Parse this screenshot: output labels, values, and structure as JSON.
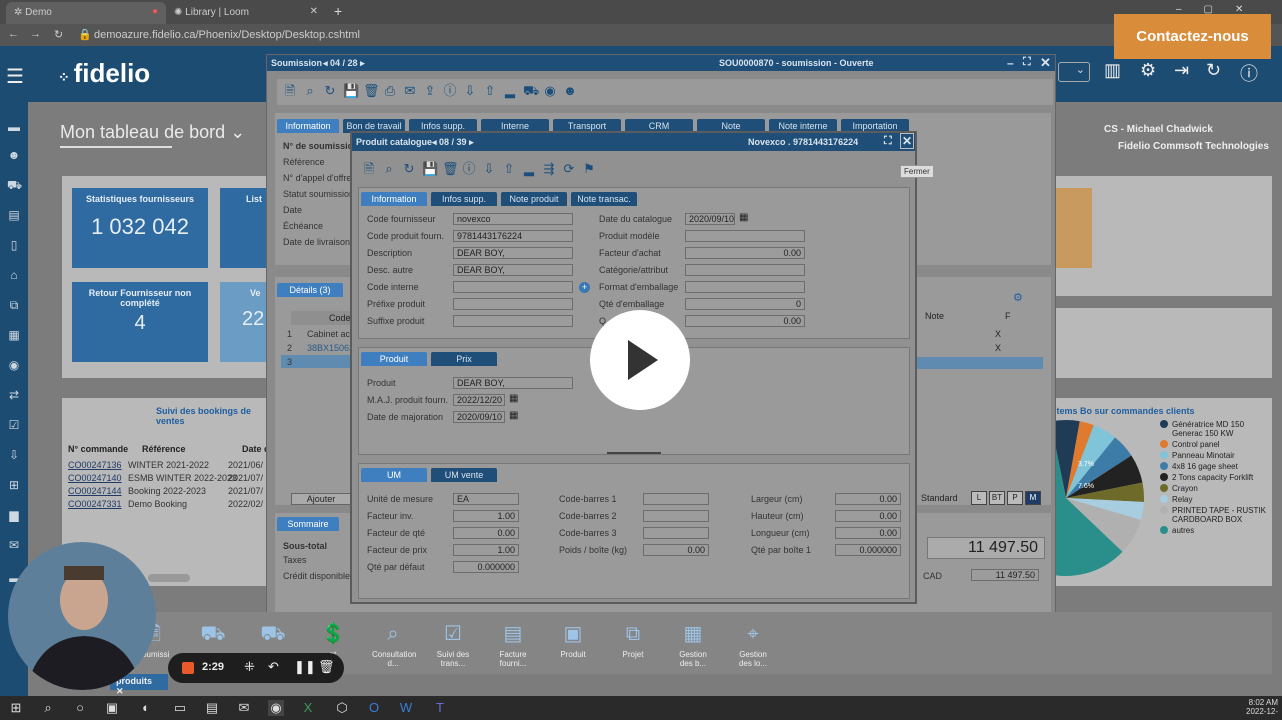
{
  "browser": {
    "tabs": [
      {
        "label": "Demo"
      },
      {
        "label": "Library | Loom"
      }
    ],
    "url": "demoazure.fidelio.ca/Phoenix/Desktop/Desktop.cshtml",
    "new_tab": "+"
  },
  "app": {
    "logo": "fidelio",
    "dashboard_title": "Mon tableau de bord",
    "user": "CS - Michael Chadwick",
    "company": "Fidelio Commsoft Technologies"
  },
  "tiles": [
    {
      "title": "Statistiques fournisseurs",
      "value": "1 032 042"
    },
    {
      "title": "List",
      "value": ""
    },
    {
      "title": "Retour Fournisseur non complété",
      "value": "4"
    },
    {
      "title": "Ve",
      "value": "22"
    }
  ],
  "soumission": {
    "title_prefix": "Soumission",
    "nav": "04 / 28",
    "header": "SOU0000870 - soumission - Ouverte",
    "tabs": [
      "Information",
      "Bon de travail",
      "Infos supp.",
      "Interne",
      "Transport",
      "CRM",
      "Note",
      "Note interne",
      "Importation"
    ],
    "labels": [
      "N° de soumission",
      "Référence",
      "N° d'appel d'offre",
      "Statut soumission",
      "Date",
      "Échéance",
      "Date de livraison"
    ],
    "details_tab": "Détails (3)",
    "col_code": "Code",
    "rows": [
      {
        "n": "1",
        "code": "Cabinet acie"
      },
      {
        "n": "2",
        "code": "38BX15063"
      },
      {
        "n": "3",
        "code": ""
      }
    ],
    "add_btn": "Ajouter",
    "summary_tab": "Sommaire",
    "summary_labels": [
      "Sous-total",
      "Taxes",
      "Crédit disponible"
    ],
    "right_cols": [
      "Note",
      "F"
    ],
    "right_marks": [
      "X",
      "X"
    ],
    "standard": "Standard",
    "size_btns": [
      "L",
      "BT",
      "P",
      "M"
    ],
    "total": "11 497.50",
    "cad_label": "CAD",
    "cad_value": "11 497.50"
  },
  "bookings": {
    "title": "Suivi des bookings de ventes",
    "headers": [
      "N° commande",
      "Référence",
      "Date c"
    ],
    "rows": [
      {
        "order": "CO00247136",
        "ref": "WINTER 2021-2022",
        "date": "2021/06/"
      },
      {
        "order": "CO00247140",
        "ref": "ESMB WINTER 2022-2023",
        "date": "2021/07/"
      },
      {
        "order": "CO00247144",
        "ref": "Booking 2022-2023",
        "date": "2021/07/"
      },
      {
        "order": "CO00247331",
        "ref": "Demo Booking",
        "date": "2022/02/"
      }
    ]
  },
  "pie": {
    "title": "Items Bo sur commandes clients",
    "legend": [
      {
        "label": "Génératrice MD 150 Generac 150 KW",
        "color": "#1f3b56"
      },
      {
        "label": "Control panel",
        "color": "#e07a2e"
      },
      {
        "label": "Panneau Minotair",
        "color": "#7fc4d8"
      },
      {
        "label": "4x8 16 gage sheet",
        "color": "#3e7ca8"
      },
      {
        "label": "2 Tons capacity Forklift",
        "color": "#222222"
      },
      {
        "label": "Crayon",
        "color": "#6e6a2a"
      },
      {
        "label": "Relay",
        "color": "#a8cde0"
      },
      {
        "label": "PRINTED TAPE - RUSTIK CARDBOARD BOX",
        "color": "#b0b0b0"
      },
      {
        "label": "autres",
        "color": "#2a8f8a"
      }
    ],
    "pct1": "3.7%",
    "pct2": "7.6%"
  },
  "modal": {
    "title": "Produit catalogue",
    "nav": "08 / 39",
    "product": "Novexco . 9781443176224",
    "close_tooltip": "Fermer",
    "tabs": [
      "Information",
      "Infos supp.",
      "Note produit",
      "Note transac."
    ],
    "left_fields": [
      {
        "label": "Code fournisseur",
        "value": "novexco"
      },
      {
        "label": "Code produit fourn.",
        "value": "9781443176224"
      },
      {
        "label": "Description",
        "value": "DEAR BOY,"
      },
      {
        "label": "Desc. autre",
        "value": "DEAR BOY,"
      },
      {
        "label": "Code interne",
        "value": ""
      },
      {
        "label": "Préfixe produit",
        "value": ""
      },
      {
        "label": "Suffixe produit",
        "value": ""
      }
    ],
    "right_fields": [
      {
        "label": "Date du catalogue",
        "value": "2020/09/10"
      },
      {
        "label": "Produit modèle",
        "value": ""
      },
      {
        "label": "Facteur d'achat",
        "value": "0.00"
      },
      {
        "label": "Catégorie/attribut",
        "value": ""
      },
      {
        "label": "Format d'emballage",
        "value": ""
      },
      {
        "label": "Qté d'emballage",
        "value": "0"
      },
      {
        "label": "Q",
        "value": "0.00"
      }
    ],
    "product_tabs": [
      "Produit",
      "Prix"
    ],
    "product_fields": [
      {
        "label": "Produit",
        "value": "DEAR BOY,"
      },
      {
        "label": "M.A.J. produit fourn.",
        "value": "2022/12/20"
      },
      {
        "label": "Date de majoration",
        "value": "2020/09/10"
      }
    ],
    "um_tabs": [
      "UM",
      "UM vente"
    ],
    "um_col1": [
      {
        "label": "Unité de mesure",
        "value": "EA"
      },
      {
        "label": "Facteur inv.",
        "value": "1.00"
      },
      {
        "label": "Facteur de qté",
        "value": "0.00"
      },
      {
        "label": "Facteur de prix",
        "value": "1.00"
      },
      {
        "label": "Qté par défaut",
        "value": "0.000000"
      }
    ],
    "um_col2": [
      {
        "label": "Code-barres 1",
        "value": ""
      },
      {
        "label": "Code-barres 2",
        "value": ""
      },
      {
        "label": "Code-barres 3",
        "value": ""
      },
      {
        "label": "Poids / boîte (kg)",
        "value": "0.00"
      }
    ],
    "um_col3": [
      {
        "label": "Largeur (cm)",
        "value": "0.00"
      },
      {
        "label": "Hauteur (cm)",
        "value": "0.00"
      },
      {
        "label": "Longueur (cm)",
        "value": "0.00"
      },
      {
        "label": "Qté par boîte 1",
        "value": "0.000000"
      }
    ]
  },
  "bottom_bar": [
    {
      "label": "Soumissi"
    },
    {
      "label": ""
    },
    {
      "label": ""
    },
    {
      "label": "nt"
    },
    {
      "label": "Consultation d..."
    },
    {
      "label": "Suivi des trans..."
    },
    {
      "label": "Facture fourni..."
    },
    {
      "label": "Produit"
    },
    {
      "label": "Projet"
    },
    {
      "label": "Gestion des b..."
    },
    {
      "label": "Gestion des lo..."
    }
  ],
  "produits_tag": "produits",
  "recorder": {
    "time": "2:29"
  },
  "contact": "Contactez-nous",
  "clock": {
    "time": "8:02 AM",
    "date": "2022-12-"
  }
}
